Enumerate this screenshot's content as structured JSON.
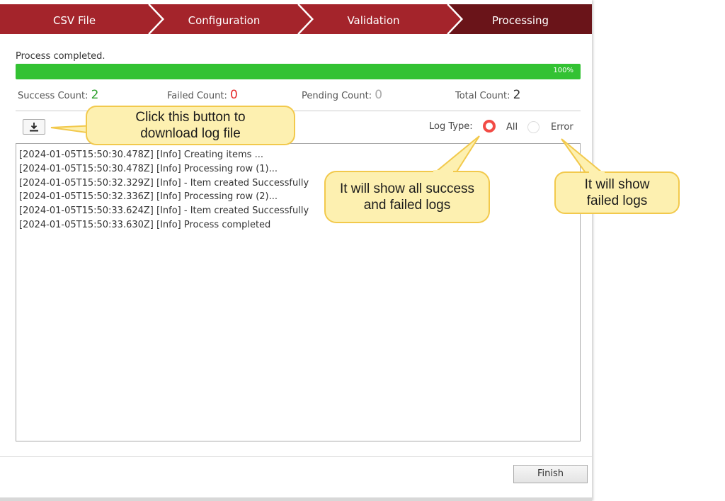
{
  "wizard": {
    "steps": [
      {
        "label": "CSV File"
      },
      {
        "label": "Configuration"
      },
      {
        "label": "Validation"
      },
      {
        "label": "Processing"
      }
    ],
    "colors": {
      "step": "#a4242b",
      "active": "#6a1419"
    }
  },
  "status": {
    "message": "Process completed.",
    "progress_percent": 100,
    "progress_label": "100%",
    "progress_color": "#33c233"
  },
  "counts": {
    "success": {
      "label": "Success Count:",
      "value": "2",
      "color": "#2ca02c"
    },
    "failed": {
      "label": "Failed Count:",
      "value": "0",
      "color": "#e52b2b"
    },
    "pending": {
      "label": "Pending Count:",
      "value": "0",
      "color": "#aaaaaa"
    },
    "total": {
      "label": "Total Count:",
      "value": "2",
      "color": "#333333"
    }
  },
  "toolbar": {
    "download_icon": "download-icon",
    "log_type_label": "Log Type:",
    "options": [
      {
        "label": "All",
        "selected": true
      },
      {
        "label": "Error",
        "selected": false
      }
    ]
  },
  "log": {
    "lines": [
      "[2024-01-05T15:50:30.478Z] [Info] Creating items ...",
      "[2024-01-05T15:50:30.478Z] [Info] Processing row (1)...",
      "[2024-01-05T15:50:32.329Z] [Info] - Item created Successfully",
      "[2024-01-05T15:50:32.336Z] [Info] Processing row (2)...",
      "[2024-01-05T15:50:33.624Z] [Info] - Item created Successfully",
      "[2024-01-05T15:50:33.630Z] [Info] Process completed"
    ]
  },
  "footer": {
    "finish_label": "Finish"
  },
  "callouts": {
    "download": {
      "line1": "Click this button to",
      "line2": "download log file"
    },
    "all": {
      "line1": "It will show all success",
      "line2": "and failed logs"
    },
    "error": {
      "line1": "It will show",
      "line2": "failed logs"
    },
    "fill": "#fdf0b0",
    "stroke": "#f2c94c"
  }
}
